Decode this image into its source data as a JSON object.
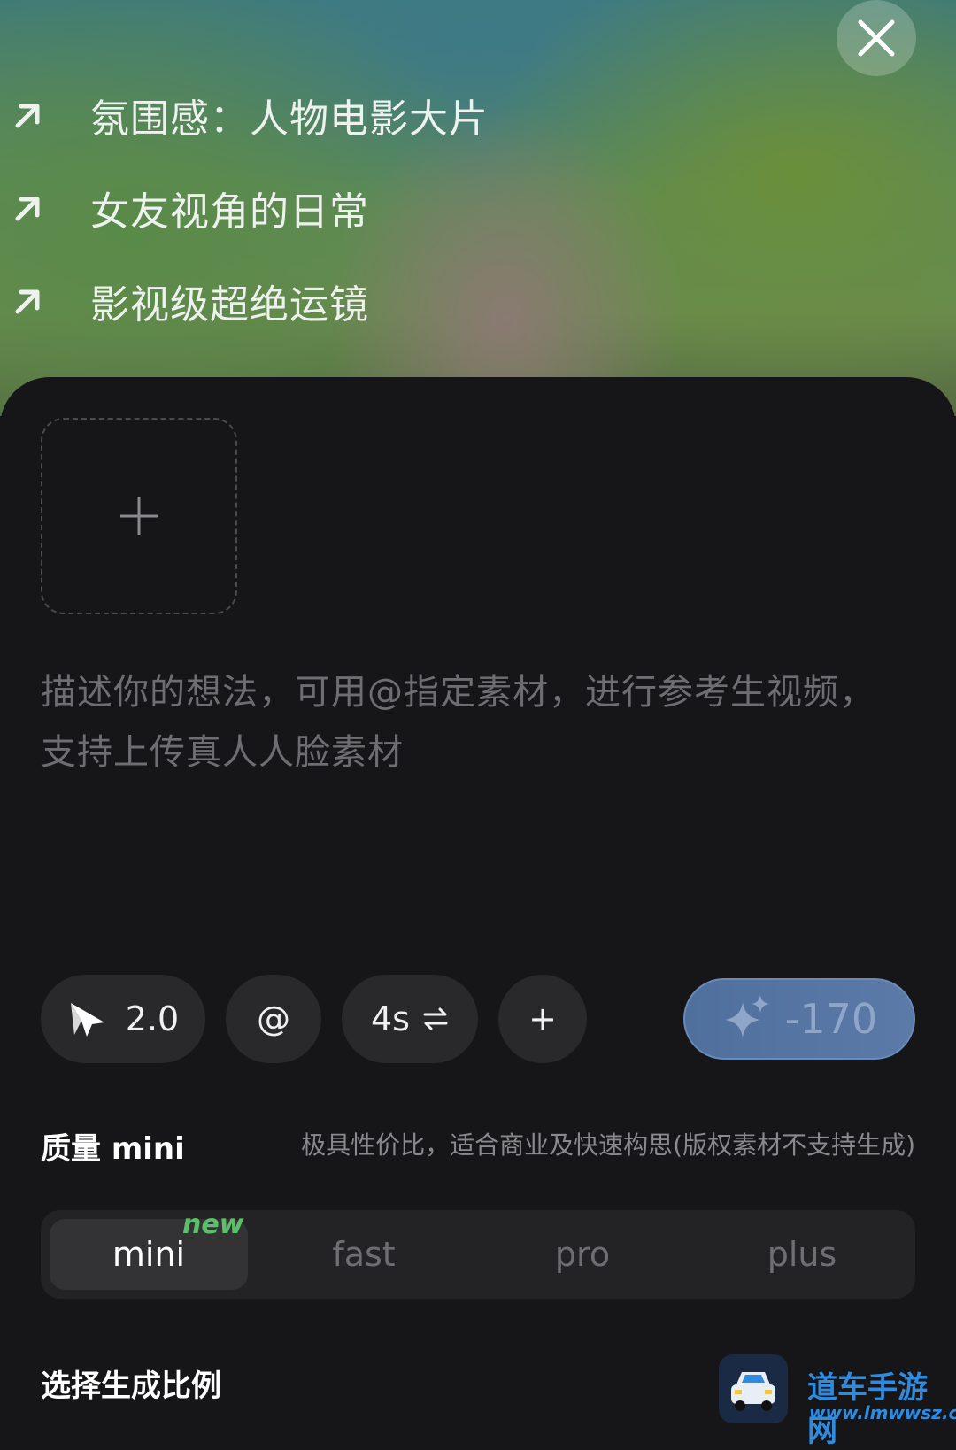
{
  "suggestions": [
    {
      "label": "氛围感：人物电影大片"
    },
    {
      "label": "女友视角的日常"
    },
    {
      "label": "影视级超绝运镜"
    }
  ],
  "prompt": {
    "placeholder_line1": "描述你的想法，可用@指定素材，进行参考生视频，",
    "placeholder_line2": "支持上传真人人脸素材"
  },
  "toolbar": {
    "model_version": "2.0",
    "mention_label": "@",
    "duration_label": "4s",
    "more_label": "+",
    "generate_cost": "-170"
  },
  "quality": {
    "label": "质量 mini",
    "description": "极具性价比，适合商业及快速构思(版权素材不支持生成)",
    "options": [
      {
        "label": "mini",
        "selected": true,
        "badge": "new"
      },
      {
        "label": "fast",
        "selected": false
      },
      {
        "label": "pro",
        "selected": false
      },
      {
        "label": "plus",
        "selected": false
      }
    ]
  },
  "ratio": {
    "label": "选择生成比例"
  },
  "watermark": {
    "title": "道车手游网",
    "url": "www.lmwwsz.com"
  },
  "colors": {
    "accent_button": "#5c7aa8",
    "new_badge": "#5cc06a",
    "panel_bg": "#161618"
  }
}
